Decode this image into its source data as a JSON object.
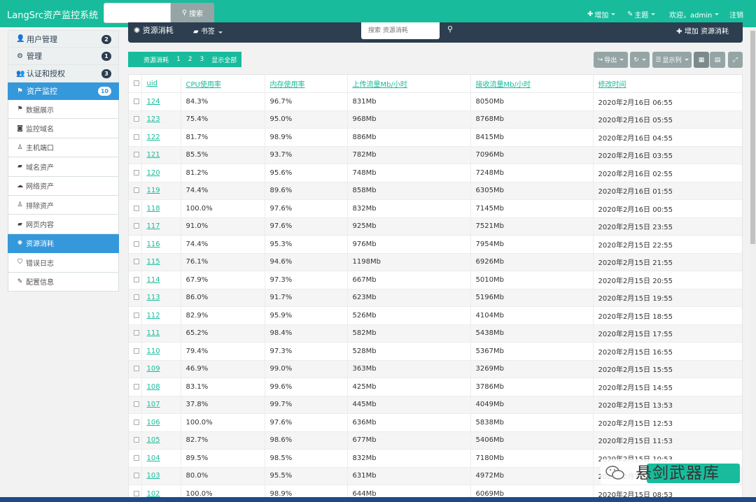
{
  "app_title": "LangSrc资产监控系统",
  "nav": {
    "search_label": "搜索",
    "add_label": "增加",
    "theme_label": "主题",
    "welcome_label": "欢迎，admin",
    "logout_label": "注销"
  },
  "sidebar": {
    "top_items": [
      {
        "label": "用户管理",
        "badge": "2",
        "icon": "user-icon"
      },
      {
        "label": "管理",
        "badge": "1",
        "icon": "gear-icon"
      },
      {
        "label": "认证和授权",
        "badge": "3",
        "icon": "users-icon"
      },
      {
        "label": "资产监控",
        "badge": "10",
        "icon": "flag-icon",
        "active": true
      }
    ],
    "sub_items": [
      {
        "label": "数据展示",
        "icon": "flag-icon"
      },
      {
        "label": "监控域名",
        "icon": "camera-icon"
      },
      {
        "label": "主机端口",
        "icon": "tux-icon"
      },
      {
        "label": "域名资产",
        "icon": "book-icon"
      },
      {
        "label": "网络资产",
        "icon": "cloud-icon"
      },
      {
        "label": "排除资产",
        "icon": "tux-icon"
      },
      {
        "label": "网页内容",
        "icon": "book-icon"
      },
      {
        "label": "资源消耗",
        "icon": "spinner-icon",
        "active": true
      },
      {
        "label": "错误日志",
        "icon": "shield-icon"
      },
      {
        "label": "配置信息",
        "icon": "pencil-icon"
      }
    ]
  },
  "panel": {
    "title": "资源消耗",
    "bookmark_label": "书签",
    "search_placeholder": "搜索 资源消耗",
    "add_label": "增加 资源消耗"
  },
  "tabs": [
    "资源消耗",
    "1",
    "2",
    "3",
    "显示全部"
  ],
  "toolbar": {
    "export_label": "导出",
    "columns_label": "显示列"
  },
  "table": {
    "columns": [
      "uid",
      "CPU使用率",
      "内存使用率",
      "上传流量Mb/小时",
      "接收流量Mb/小时",
      "修改时间"
    ],
    "rows": [
      [
        "124",
        "84.3%",
        "96.7%",
        "831Mb",
        "8050Mb",
        "2020年2月16日 06:55"
      ],
      [
        "123",
        "75.4%",
        "95.0%",
        "968Mb",
        "8768Mb",
        "2020年2月16日 05:55"
      ],
      [
        "122",
        "81.7%",
        "98.9%",
        "886Mb",
        "8415Mb",
        "2020年2月16日 04:55"
      ],
      [
        "121",
        "85.5%",
        "93.7%",
        "782Mb",
        "7096Mb",
        "2020年2月16日 03:55"
      ],
      [
        "120",
        "81.2%",
        "95.6%",
        "748Mb",
        "7248Mb",
        "2020年2月16日 02:55"
      ],
      [
        "119",
        "74.4%",
        "89.6%",
        "858Mb",
        "6305Mb",
        "2020年2月16日 01:55"
      ],
      [
        "118",
        "100.0%",
        "97.6%",
        "832Mb",
        "7145Mb",
        "2020年2月16日 00:55"
      ],
      [
        "117",
        "91.0%",
        "97.6%",
        "925Mb",
        "7521Mb",
        "2020年2月15日 23:55"
      ],
      [
        "116",
        "74.4%",
        "95.3%",
        "976Mb",
        "7954Mb",
        "2020年2月15日 22:55"
      ],
      [
        "115",
        "76.1%",
        "94.6%",
        "1198Mb",
        "6926Mb",
        "2020年2月15日 21:55"
      ],
      [
        "114",
        "67.9%",
        "97.3%",
        "667Mb",
        "5010Mb",
        "2020年2月15日 20:55"
      ],
      [
        "113",
        "86.0%",
        "91.7%",
        "623Mb",
        "5196Mb",
        "2020年2月15日 19:55"
      ],
      [
        "112",
        "82.9%",
        "95.9%",
        "526Mb",
        "4104Mb",
        "2020年2月15日 18:55"
      ],
      [
        "111",
        "65.2%",
        "98.4%",
        "582Mb",
        "5438Mb",
        "2020年2月15日 17:55"
      ],
      [
        "110",
        "79.4%",
        "97.3%",
        "528Mb",
        "5367Mb",
        "2020年2月15日 16:55"
      ],
      [
        "109",
        "46.9%",
        "99.0%",
        "363Mb",
        "3269Mb",
        "2020年2月15日 15:55"
      ],
      [
        "108",
        "83.1%",
        "99.6%",
        "425Mb",
        "3786Mb",
        "2020年2月15日 14:55"
      ],
      [
        "107",
        "37.8%",
        "99.7%",
        "445Mb",
        "4049Mb",
        "2020年2月15日 13:53"
      ],
      [
        "106",
        "100.0%",
        "97.6%",
        "636Mb",
        "5838Mb",
        "2020年2月15日 12:53"
      ],
      [
        "105",
        "82.7%",
        "98.6%",
        "677Mb",
        "5406Mb",
        "2020年2月15日 11:53"
      ],
      [
        "104",
        "89.5%",
        "98.5%",
        "832Mb",
        "7180Mb",
        "2020年2月15日 10:53"
      ],
      [
        "103",
        "80.0%",
        "95.5%",
        "631Mb",
        "4972Mb",
        "2020年2月15日 09:53"
      ],
      [
        "102",
        "100.0%",
        "98.9%",
        "644Mb",
        "6069Mb",
        "2020年2月15日 08:53"
      ]
    ]
  },
  "watermark": {
    "text": "悬剑武器库"
  },
  "colors": {
    "navbar": "#18bc9c",
    "panel_head": "#2c3e50",
    "active": "#3498db",
    "link": "#18bc9c"
  }
}
